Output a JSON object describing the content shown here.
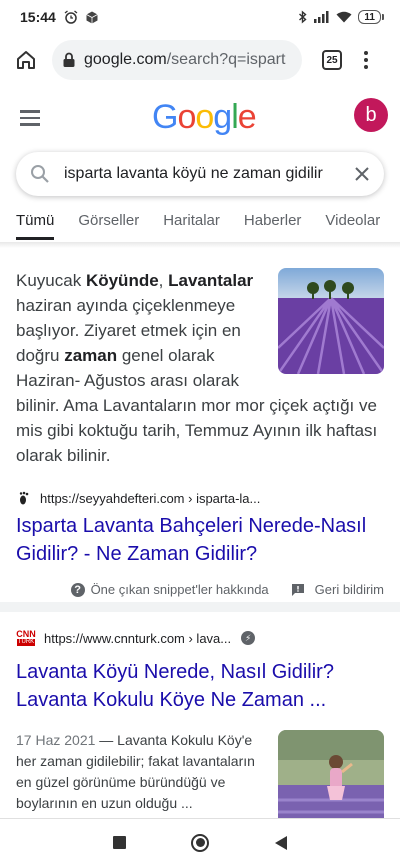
{
  "status_bar": {
    "time": "15:44",
    "battery": "11"
  },
  "browser": {
    "url_host": "google.com",
    "url_path": "/search?q=ispart",
    "tab_count": "25"
  },
  "google": {
    "logo_letters": [
      {
        "ch": "G",
        "color": "#4285F4"
      },
      {
        "ch": "o",
        "color": "#EA4335"
      },
      {
        "ch": "o",
        "color": "#FBBC05"
      },
      {
        "ch": "g",
        "color": "#4285F4"
      },
      {
        "ch": "l",
        "color": "#34A853"
      },
      {
        "ch": "e",
        "color": "#EA4335"
      }
    ],
    "avatar_letter": "b",
    "query": "isparta lavanta köyü ne zaman gidilir"
  },
  "tabs": [
    "Tümü",
    "Görseller",
    "Haritalar",
    "Haberler",
    "Videolar"
  ],
  "featured_snippet": {
    "parts": [
      {
        "t": "Kuyucak ",
        "b": false
      },
      {
        "t": "Köyünde",
        "b": true
      },
      {
        "t": ", ",
        "b": false
      },
      {
        "t": "Lavantalar",
        "b": true
      },
      {
        "t": " haziran ayında çiçeklenmeye başlıyor. Ziyaret etmek için en doğru ",
        "b": false
      },
      {
        "t": "zaman",
        "b": true
      },
      {
        "t": " genel olarak Haziran- Ağustos arası olarak bilinir. Ama Lavantaların mor mor çiçek açtığı ve mis gibi koktuğu tarih, Temmuz Ayının ilk haftası olarak bilinir.",
        "b": false
      }
    ],
    "source_url": "https://seyyahdefteri.com › isparta-la...",
    "title": "Isparta Lavanta Bahçeleri Nerede-Nasıl Gidilir? - Ne Zaman Gidilir?",
    "about_label": "Öne çıkan snippet'ler hakkında",
    "feedback_label": "Geri bildirim"
  },
  "result2": {
    "source_url": "https://www.cnnturk.com › lava...",
    "favicon_text": "CNN",
    "favicon_sub": "TÜRK",
    "title": "Lavanta Köyü Nerede, Nasıl Gidilir? Lavanta Kokulu Köye Ne Zaman ...",
    "date": "17 Haz 2021",
    "snippet": " — Lavanta Kokulu Köy'e her zaman gidilebilir; fakat lavantaların en güzel görünüme büründüğü ve boylarının en uzun olduğu  ..."
  }
}
